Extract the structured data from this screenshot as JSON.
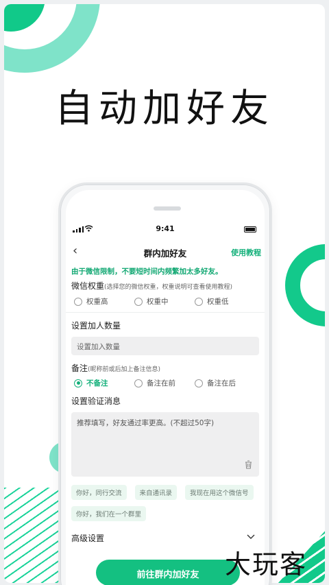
{
  "hero": {
    "title": "自动加好友"
  },
  "status": {
    "time": "9:41"
  },
  "nav": {
    "back": "‹",
    "title": "群内加好友",
    "action": "使用教程"
  },
  "warning": "由于微信限制，不要短时间内频繁加太多好友。",
  "weight": {
    "title": "微信权重",
    "hint": "(选择您的微信权重，权重说明可查看使用教程)",
    "options": [
      "权重高",
      "权重中",
      "权重低"
    ]
  },
  "count": {
    "title": "设置加人数量",
    "placeholder": "设置加入数量"
  },
  "remark": {
    "title": "备注",
    "hint": "(昵称前或后加上备注信息)",
    "options": [
      "不备注",
      "备注在前",
      "备注在后"
    ],
    "selected": "不备注"
  },
  "verify": {
    "title": "设置验证消息",
    "placeholder": "推荐填写，好友通过率更高。(不超过50字)",
    "chips": [
      "你好，同行交流",
      "来自通讯录",
      "我现在用这个微信号",
      "你好，我们在一个群里"
    ]
  },
  "advanced": {
    "label": "高级设置"
  },
  "cta": {
    "label": "前往群内加好友"
  },
  "watermark": "大玩客",
  "colors": {
    "accent": "#13c98b",
    "accent_light": "#7fe3c9"
  }
}
